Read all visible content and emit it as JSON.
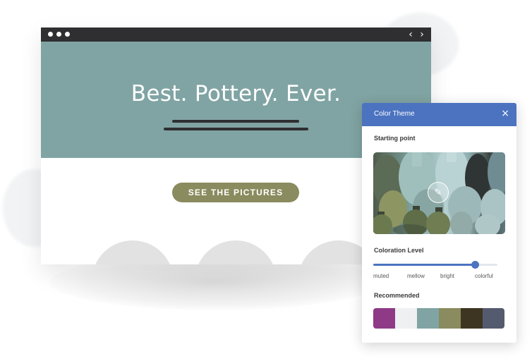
{
  "hero": {
    "title": "Best. Pottery. Ever.",
    "background_color": "#80a4a3"
  },
  "browser": {
    "nav_back_icon": "chevron-left-icon",
    "nav_forward_icon": "chevron-right-icon",
    "nav_back": "‹",
    "nav_forward": "›"
  },
  "cta": {
    "label": "SEE THE PICTURES",
    "color": "#8a8b5e"
  },
  "panel": {
    "title": "Color Theme",
    "close_icon": "×",
    "header_color": "#4b73c0",
    "starting_point_label": "Starting point",
    "photo_button_icon": "eyedropper-icon",
    "coloration_label": "Coloration Level",
    "coloration_value": 0.82,
    "coloration_levels": [
      "muted",
      "mellow",
      "bright",
      "colorful"
    ],
    "recommended_label": "Recommended",
    "recommended_colors": [
      "#8e3a87",
      "#eef0f1",
      "#80a4a3",
      "#8a8b5e",
      "#3d3521",
      "#555b6e"
    ]
  }
}
